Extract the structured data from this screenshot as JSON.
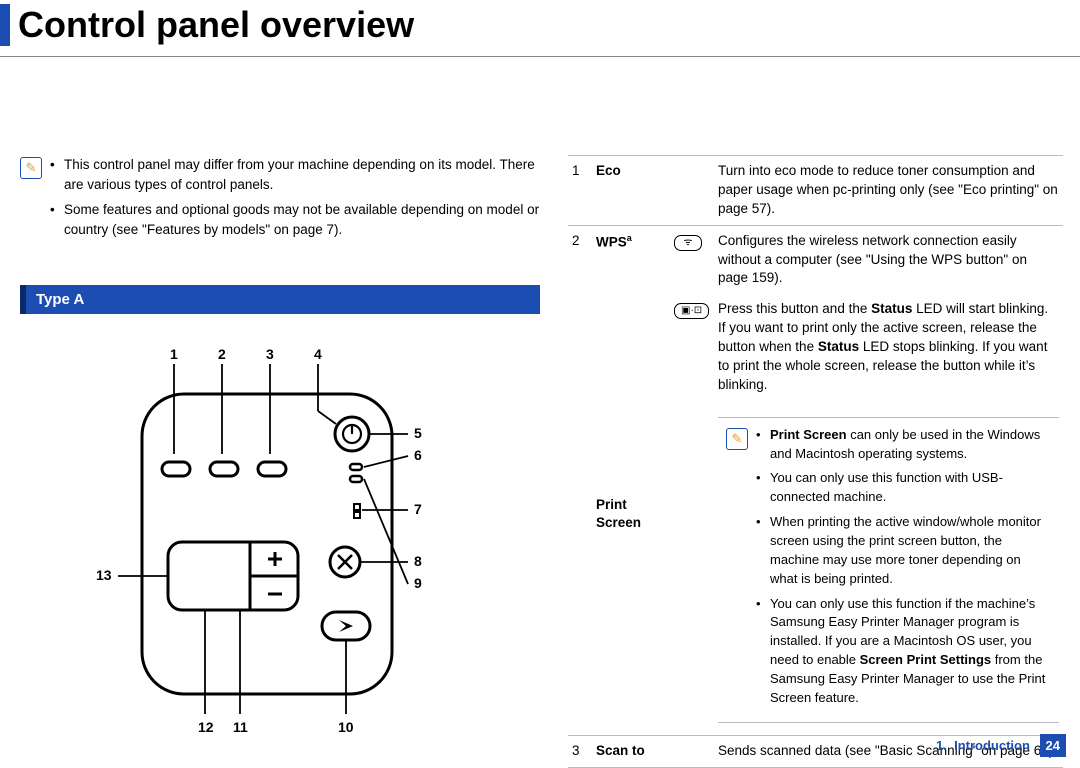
{
  "title": "Control panel overview",
  "intro_notes": [
    "This control panel may differ from your machine depending on its model. There are various types of control panels.",
    "Some features and optional goods may not be available depending on model or country (see \"Features by models\" on page 7)."
  ],
  "section_heading": "Type A",
  "callouts": [
    "1",
    "2",
    "3",
    "4",
    "5",
    "6",
    "7",
    "8",
    "9",
    "10",
    "11",
    "12",
    "13"
  ],
  "table": {
    "rows": [
      {
        "num": "1",
        "name": "Eco",
        "icon": "",
        "desc": {
          "plain": "Turn into eco mode to reduce toner consumption and paper usage when pc-printing only (see \"Eco printing\" on page 57)."
        }
      },
      {
        "num": "2",
        "name_html": "WPS<span class='sup'>a</span>",
        "name": "WPSa",
        "icon": "wps",
        "desc": {
          "plain": "Configures the wireless network connection easily without a computer (see \"Using the WPS button\" on page 159)."
        }
      },
      {
        "num": "",
        "name": "Print Screen",
        "icon": "printscreen",
        "desc": {
          "html": "Press this button and the <b>Status</b> LED will start blinking. If you want to print only the active screen, release the button when the <b>Status</b> LED stops blinking. If you want to print the whole screen, release the button while it’s blinking."
        }
      },
      {
        "num": "3",
        "name": "Scan to",
        "icon": "",
        "desc": {
          "plain": "Sends scanned data (see \"Basic Scanning\" on page 64)."
        }
      }
    ],
    "ps_sub_notes": [
      "<b>Print Screen</b> can only be used in the Windows and Macintosh operating systems.",
      "You can only use this function with USB-connected machine.",
      "When printing the active window/whole monitor screen using the print screen button, the machine may use more toner depending on what is being printed.",
      "You can only use this function if the machine’s Samsung Easy Printer Manager program is installed. If you are a Macintosh OS user, you need to enable <b>Screen Print Settings</b> from the Samsung Easy Printer Manager to use the Print Screen feature."
    ]
  },
  "footer": {
    "chapter": "1.",
    "label": "Introduction",
    "page": "24"
  }
}
